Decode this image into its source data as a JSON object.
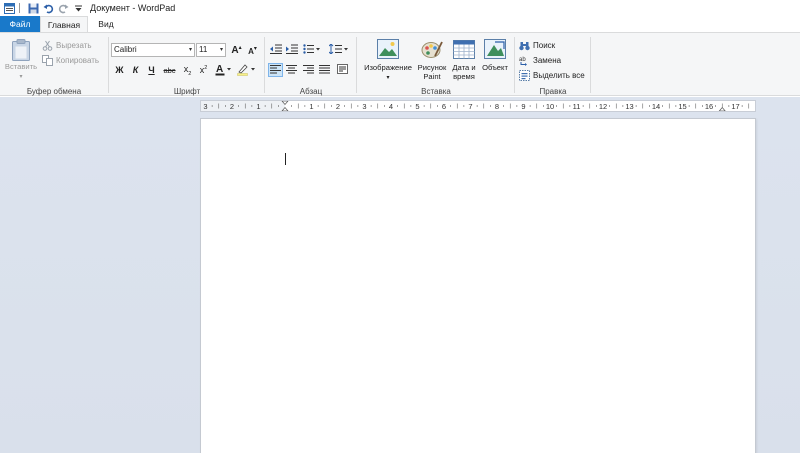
{
  "window": {
    "title": "Документ - WordPad"
  },
  "quick_access": {
    "icons": [
      "wordpad-app-icon",
      "save-icon",
      "undo-icon",
      "redo-icon",
      "customize-dropdown-icon"
    ]
  },
  "tabs": [
    {
      "label": "Файл"
    },
    {
      "label": "Главная"
    },
    {
      "label": "Вид"
    }
  ],
  "ribbon": {
    "clipboard": {
      "label": "Буфер обмена",
      "paste": "Вставить",
      "cut": "Вырезать",
      "copy": "Копировать"
    },
    "font": {
      "label": "Шрифт",
      "family": "Calibri",
      "size": "11"
    },
    "paragraph": {
      "label": "Абзац"
    },
    "insert": {
      "label": "Вставка",
      "image_line1": "Изображение",
      "paint_line1": "Рисунок",
      "paint_line2": "Paint",
      "datetime_line1": "Дата и",
      "datetime_line2": "время",
      "object": "Объект"
    },
    "editing": {
      "label": "Правка",
      "find": "Поиск",
      "replace": "Замена",
      "select_all": "Выделить все"
    }
  },
  "ruler": {
    "labels": [
      "3",
      "2",
      "1",
      "1",
      "2",
      "3",
      "4",
      "5",
      "6",
      "7",
      "8",
      "9",
      "10",
      "11",
      "12",
      "13",
      "14",
      "15",
      "16",
      "17"
    ]
  },
  "colors": {
    "file_tab": "#1979ca",
    "ribbon_bg": "#f5f6f7",
    "workspace_bg": "#dce3ee",
    "selected_button": "#cce4f7"
  }
}
